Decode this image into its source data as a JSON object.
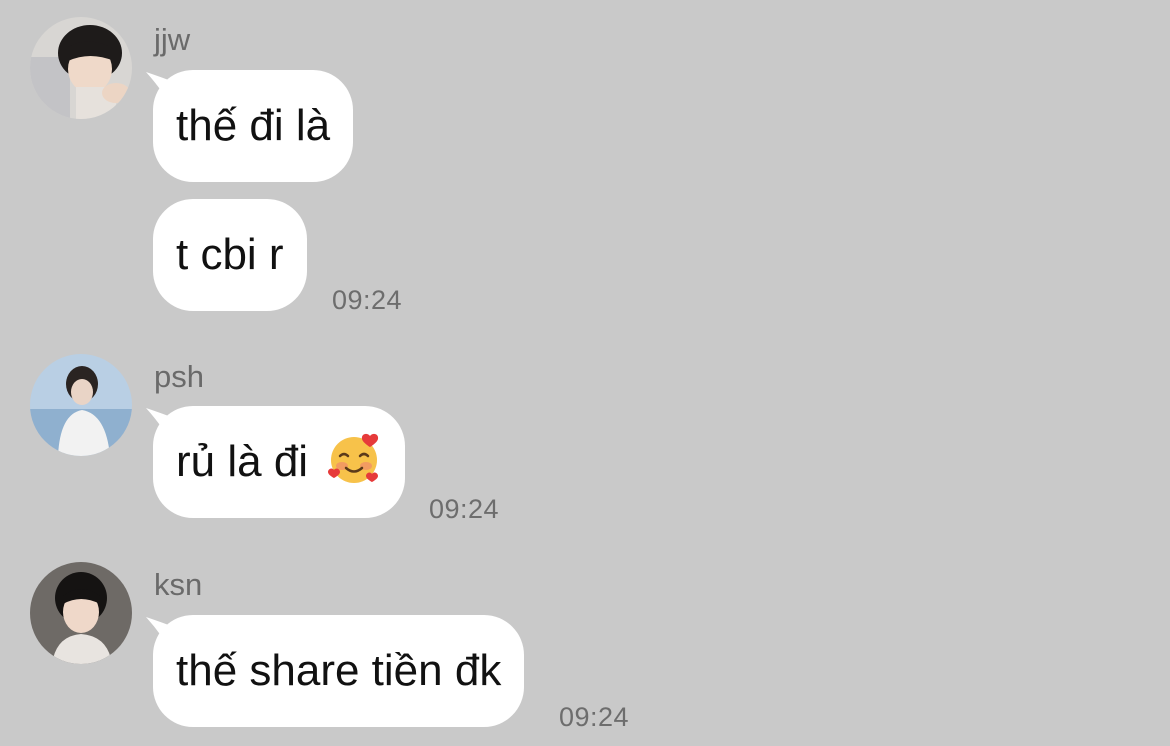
{
  "messages": [
    {
      "sender": "jjw",
      "bubbles": [
        "thế đi là",
        "t cbi r"
      ],
      "time": "09:24"
    },
    {
      "sender": "psh",
      "bubbles": [
        "rủ là đi"
      ],
      "emoji": "smiling-face-with-hearts",
      "time": "09:24"
    },
    {
      "sender": "ksn",
      "bubbles": [
        "thế share tiền đk"
      ],
      "time": "09:24"
    }
  ],
  "colors": {
    "background": "#c9c9c9",
    "bubble": "#ffffff",
    "sender_text": "#6a6a6a",
    "time_text": "#6d6d6d"
  }
}
